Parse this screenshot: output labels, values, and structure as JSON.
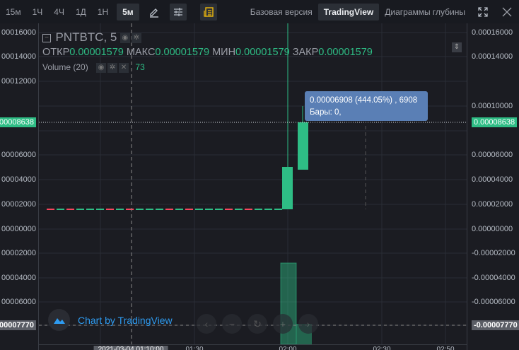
{
  "toolbar": {
    "timeframes": [
      "15м",
      "1Ч",
      "4Ч",
      "1Д",
      "1Н"
    ],
    "active_timeframe": "5м",
    "tabs": [
      "Базовая версия",
      "TradingView",
      "Диаграммы глубины"
    ],
    "active_tab": "TradingView"
  },
  "legend": {
    "symbol": "PNTBTC, 5",
    "open_label": "ОТКР",
    "open": "0.00001579",
    "high_label": "МАКС",
    "high": "0.00001579",
    "low_label": "МИН",
    "low": "0.00001579",
    "close_label": "ЗАКР",
    "close": "0.00001579",
    "volume_label": "Volume (20)",
    "volume": "73"
  },
  "left_axis": [
    "00016000",
    "00014000",
    "00012000",
    "00008638",
    "00006000",
    "00004000",
    "00002000",
    "00000000",
    "00002000",
    "00004000",
    "00006000",
    "00007770"
  ],
  "right_axis": [
    "0.00016000",
    "0.00014000",
    "0.00010000",
    "0.00008638",
    "0.00006000",
    "0.00004000",
    "0.00002000",
    "0.00000000",
    "-0.00002000",
    "-0.00004000",
    "-0.00006000",
    "-0.00007770"
  ],
  "tooltip": {
    "line1": "0.00006908 (444.05%) , 6908",
    "line2": "Бары: 0,"
  },
  "branding": "Chart by TradingView",
  "x_axis": [
    "2021-03-04 01:10:00",
    "01:30",
    "02:00",
    "02:30",
    "02:50"
  ],
  "colors": {
    "up": "#2ebd85",
    "down": "#f6465d",
    "accent": "#f0b90b"
  }
}
